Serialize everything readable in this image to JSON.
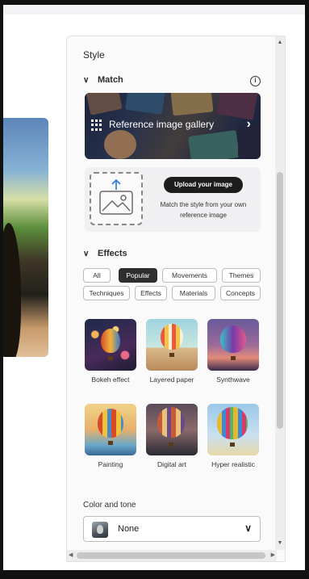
{
  "panel": {
    "title": "Style",
    "match": {
      "header": "Match",
      "gallery_label": "Reference image gallery",
      "upload_button": "Upload your image",
      "upload_description": "Match the style from your own reference image"
    },
    "effects": {
      "header": "Effects",
      "filters": [
        {
          "label": "All",
          "active": false
        },
        {
          "label": "Popular",
          "active": true
        },
        {
          "label": "Movements",
          "active": false
        },
        {
          "label": "Themes",
          "active": false
        },
        {
          "label": "Techniques",
          "active": false
        },
        {
          "label": "Effects",
          "active": false
        },
        {
          "label": "Materials",
          "active": false
        },
        {
          "label": "Concepts",
          "active": false
        }
      ],
      "items": [
        {
          "label": "Bokeh effect"
        },
        {
          "label": "Layered paper"
        },
        {
          "label": "Synthwave"
        },
        {
          "label": "Painting"
        },
        {
          "label": "Digital art"
        },
        {
          "label": "Hyper realistic"
        }
      ]
    },
    "color_tone": {
      "label": "Color and tone",
      "selected": "None"
    }
  },
  "icons": [
    "chevron-down-icon",
    "info-icon",
    "gallery-grid-icon",
    "chevron-right-icon",
    "upload-image-icon",
    "dropdown-caret-icon"
  ]
}
